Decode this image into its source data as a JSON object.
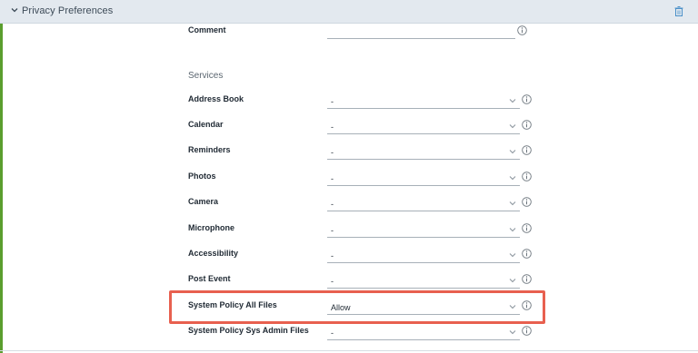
{
  "header": {
    "title": "Privacy Preferences",
    "collapse_icon": "chevron-down-icon",
    "delete_icon": "trash-icon"
  },
  "comment": {
    "label": "Comment",
    "value": ""
  },
  "services": {
    "heading": "Services",
    "rows": [
      {
        "label": "Address Book",
        "value": "-"
      },
      {
        "label": "Calendar",
        "value": "-"
      },
      {
        "label": "Reminders",
        "value": "-"
      },
      {
        "label": "Photos",
        "value": "-"
      },
      {
        "label": "Camera",
        "value": "-"
      },
      {
        "label": "Microphone",
        "value": "-"
      },
      {
        "label": "Accessibility",
        "value": "-"
      },
      {
        "label": "Post Event",
        "value": "-"
      },
      {
        "label": "System Policy All Files",
        "value": "Allow"
      },
      {
        "label": "System Policy Sys Admin Files",
        "value": "-"
      }
    ]
  },
  "colors": {
    "accent": "#5a9e2e",
    "highlight": "#e8604f",
    "header_bg": "#e3e9ef"
  }
}
